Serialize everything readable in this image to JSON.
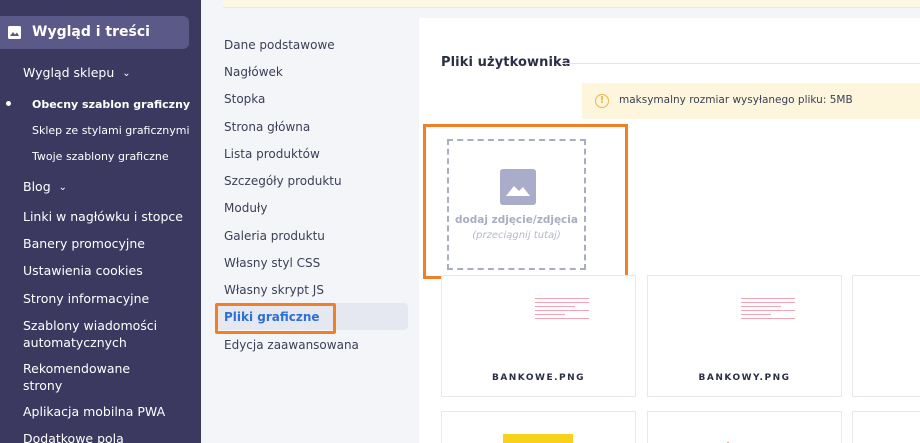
{
  "sidebar": {
    "active_section": "Wygląd i treści",
    "items": [
      {
        "label": "Wygląd sklepu"
      },
      {
        "label": "Blog"
      },
      {
        "label": "Linki w nagłówku i stopce"
      },
      {
        "label": "Banery promocyjne"
      },
      {
        "label": "Ustawienia cookies"
      },
      {
        "label": "Strony informacyjne"
      },
      {
        "label": "Szablony wiadomości automatycznych"
      },
      {
        "label": "Rekomendowane strony"
      },
      {
        "label": "Aplikacja mobilna PWA"
      },
      {
        "label": "Dodatkowe pola"
      }
    ],
    "subitems": [
      {
        "label": "Obecny szablon graficzny"
      },
      {
        "label": "Sklep ze stylami graficznymi"
      },
      {
        "label": "Twoje szablony graficzne"
      }
    ]
  },
  "midnav": {
    "items": [
      {
        "label": "Dane podstawowe"
      },
      {
        "label": "Nagłówek"
      },
      {
        "label": "Stopka"
      },
      {
        "label": "Strona główna"
      },
      {
        "label": "Lista produktów"
      },
      {
        "label": "Szczegóły produktu"
      },
      {
        "label": "Moduły"
      },
      {
        "label": "Galeria produktu"
      },
      {
        "label": "Własny styl CSS"
      },
      {
        "label": "Własny skrypt JS"
      },
      {
        "label": "Pliki graficzne"
      },
      {
        "label": "Edycja zaawansowana"
      }
    ],
    "active": "Pliki graficzne"
  },
  "main": {
    "title": "Pliki użytkownika",
    "notice": "maksymalny rozmiar wysyłanego pliku: 5MB",
    "upload": {
      "label": "dodaj zdjęcie/zdjęcia",
      "hint": "(przeciągnij tutaj)"
    },
    "files": [
      {
        "name": "BANKOWE.PNG"
      },
      {
        "name": "BANKOWY.PNG"
      }
    ]
  },
  "colors": {
    "sidebar_bg": "#3b3960",
    "sidebar_active": "#5b5987",
    "accent_blue": "#2e6fd8",
    "highlight_orange": "#f07f25",
    "notice_bg": "#fdf6dc"
  }
}
